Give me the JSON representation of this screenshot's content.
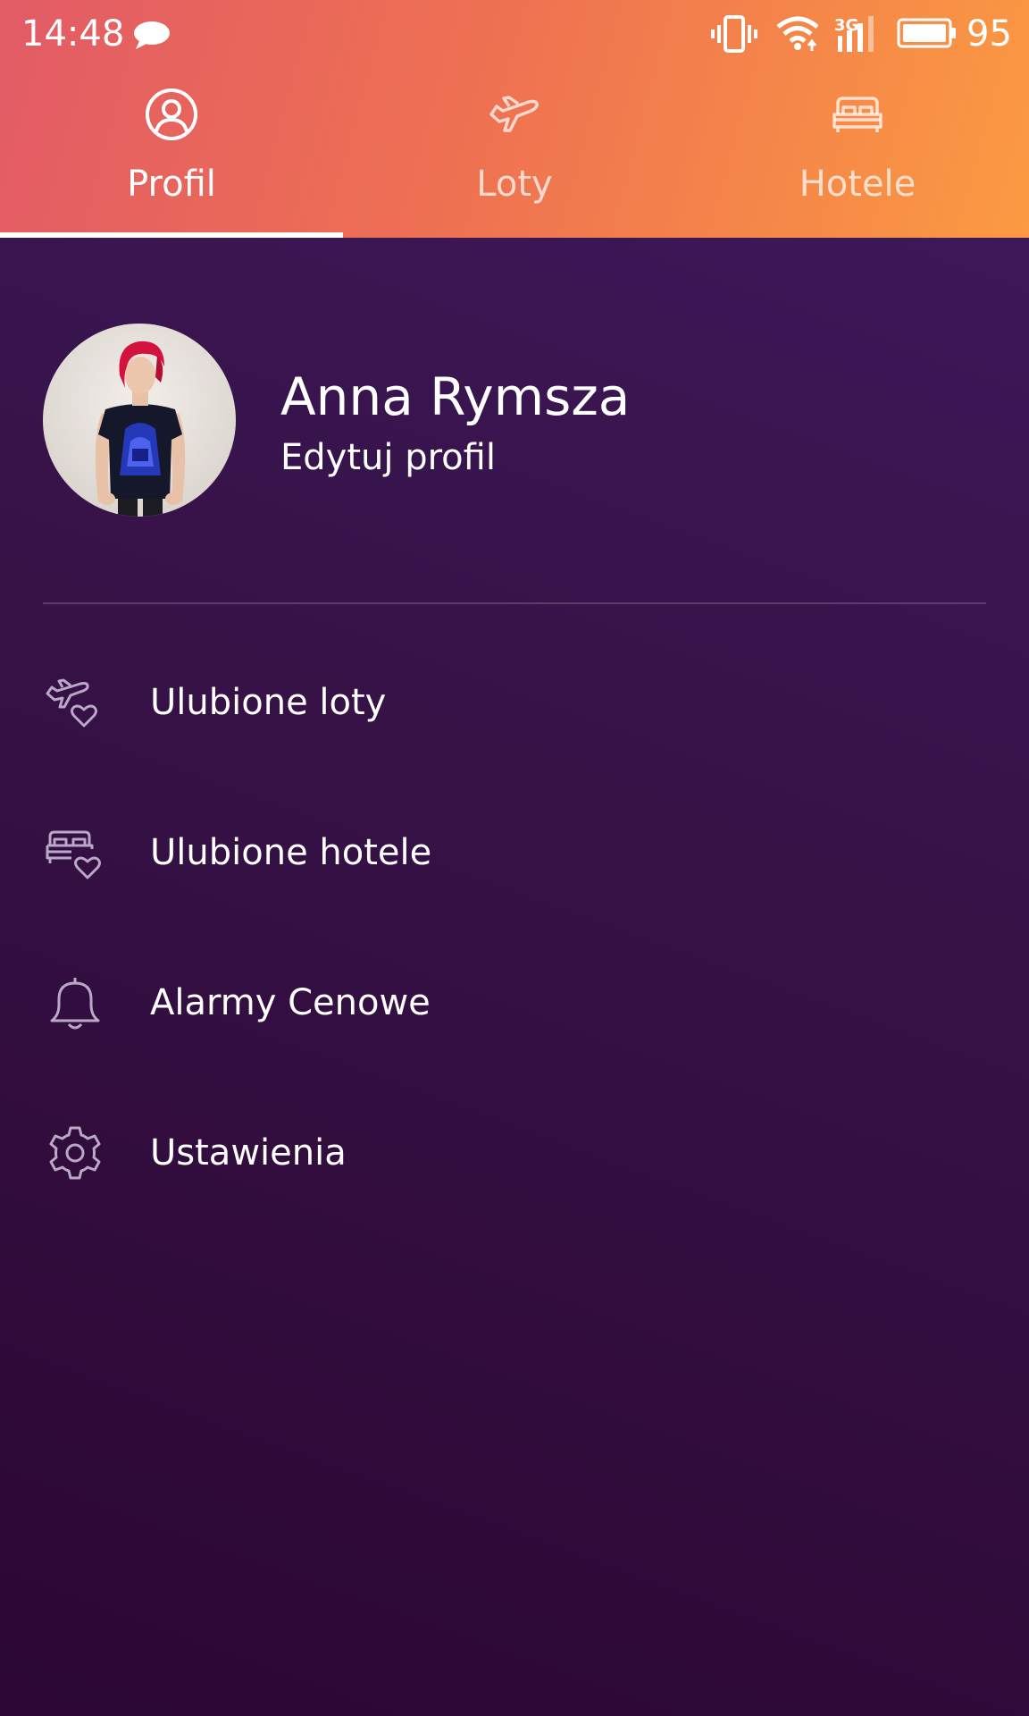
{
  "status_bar": {
    "time": "14:48",
    "battery": "95",
    "icons": [
      "message-icon",
      "vibrate-icon",
      "wifi-icon",
      "signal-3g-icon",
      "battery-icon"
    ]
  },
  "tabs": [
    {
      "label": "Profil",
      "icon": "profile-icon",
      "active": true
    },
    {
      "label": "Loty",
      "icon": "plane-icon",
      "active": false
    },
    {
      "label": "Hotele",
      "icon": "bed-icon",
      "active": false
    }
  ],
  "profile": {
    "name": "Anna Rymsza",
    "edit_label": "Edytuj profil"
  },
  "menu": {
    "items": [
      {
        "label": "Ulubione loty",
        "icon": "favorite-flights-icon"
      },
      {
        "label": "Ulubione hotele",
        "icon": "favorite-hotels-icon"
      },
      {
        "label": "Alarmy Cenowe",
        "icon": "bell-icon"
      },
      {
        "label": "Ustawienia",
        "icon": "gear-icon"
      }
    ]
  },
  "colors": {
    "header_gradient_start": "#e25b66",
    "header_gradient_end": "#fb9a42",
    "background_top": "#3f1a5e",
    "background_bottom": "#2c0733",
    "menu_icon": "#b9a8c6"
  }
}
